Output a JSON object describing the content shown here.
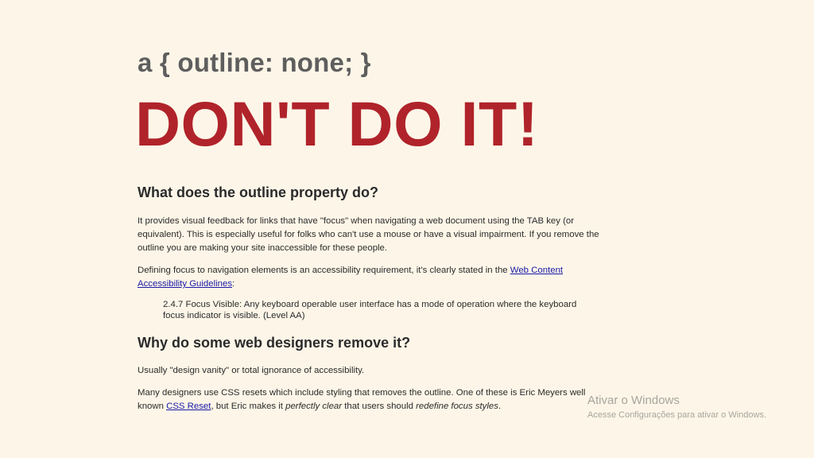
{
  "header": {
    "code_title": "a { outline: none; }",
    "warning": "DON'T DO IT!"
  },
  "section1": {
    "heading": "What does the outline property do?",
    "paragraph1": "It provides visual feedback for links that have \"focus\" when navigating a web document using the TAB key (or equivalent). This is especially useful for folks who can't use a mouse or have a visual impairment. If you remove the outline you are making your site inaccessible for these people.",
    "paragraph2_before": "Defining focus to navigation elements is an accessibility requirement, it's clearly stated in the ",
    "paragraph2_link": "Web Content Accessibility Guidelines",
    "paragraph2_after": ":",
    "quote": "2.4.7 Focus Visible: Any keyboard operable user interface has a mode of operation where the keyboard focus indicator is visible. (Level AA)"
  },
  "section2": {
    "heading": "Why do some web designers remove it?",
    "paragraph1": "Usually \"design vanity\" or total ignorance of accessibility.",
    "paragraph2_part1": "Many designers use CSS resets which include styling that removes the outline. One of these is Eric Meyers well known ",
    "paragraph2_link": "CSS Reset",
    "paragraph2_part2": ", but Eric makes it ",
    "paragraph2_em1": "perfectly clear",
    "paragraph2_part3": " that users should ",
    "paragraph2_em2": "redefine focus styles",
    "paragraph2_part4": "."
  },
  "watermark": {
    "title": "Ativar o Windows",
    "subtitle": "Acesse Configurações para ativar o Windows."
  },
  "colors": {
    "background": "#fdf6e8",
    "warning": "#b0232a",
    "code_title": "#5e5e5e",
    "link": "#1a1aa6"
  }
}
